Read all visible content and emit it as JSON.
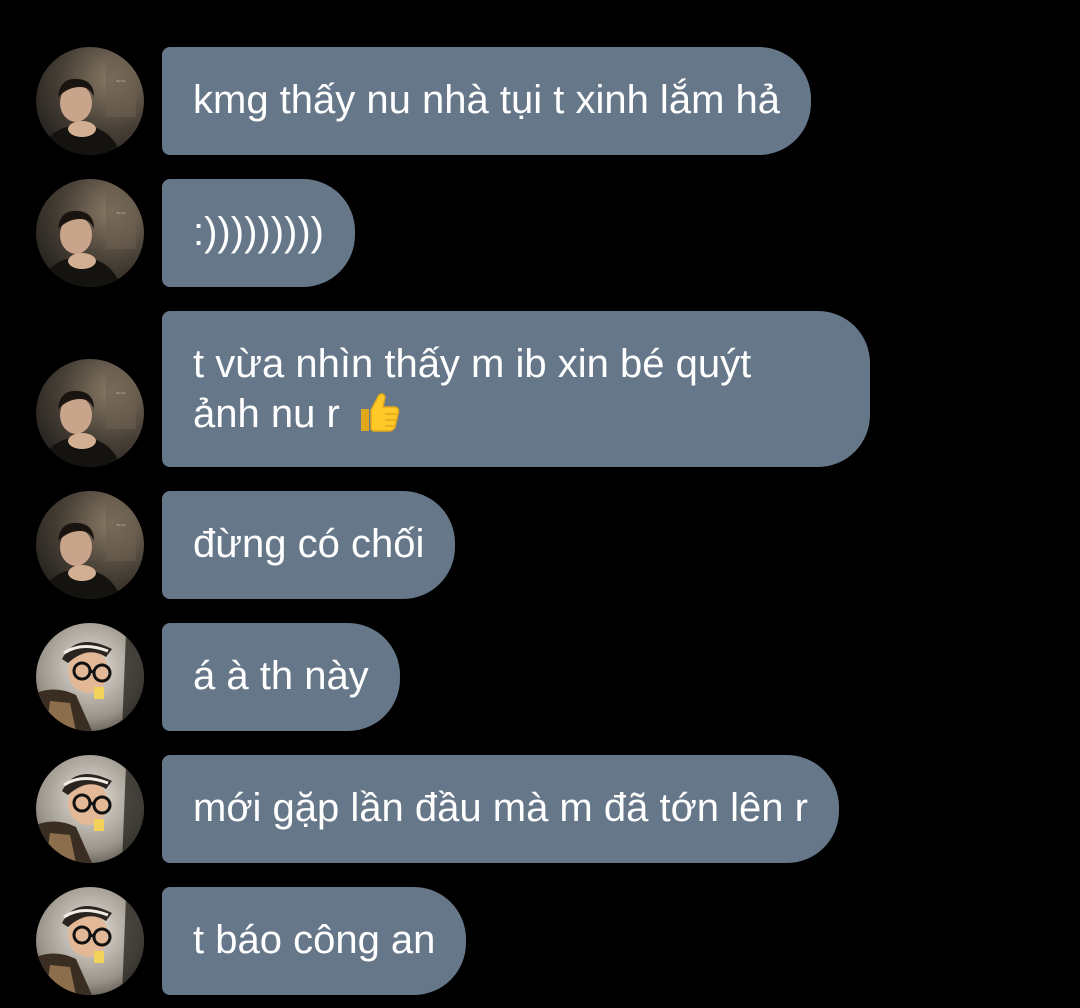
{
  "messages": [
    {
      "sender": "a",
      "text": "kmg thấy nu nhà tụi t xinh lắm hả"
    },
    {
      "sender": "a",
      "text": ":)))))))))"
    },
    {
      "sender": "a",
      "text": "t vừa nhìn thấy m ib xin bé quýt",
      "text2": "ảnh nu r",
      "emoji": "thumbs-up"
    },
    {
      "sender": "a",
      "text": "đừng có chối"
    },
    {
      "sender": "b",
      "text": "á à th này"
    },
    {
      "sender": "b",
      "text": "mới gặp lần đầu mà m đã tớn lên r"
    },
    {
      "sender": "b",
      "text": "t báo công an"
    }
  ],
  "colors": {
    "background": "#000000",
    "bubble": "#667789",
    "text": "#ffffff"
  }
}
